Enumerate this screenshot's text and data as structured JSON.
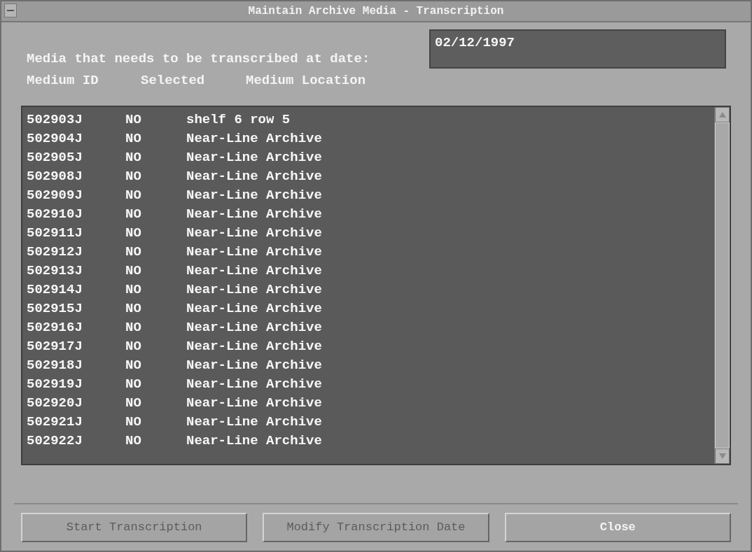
{
  "window": {
    "title": "Maintain Archive Media - Transcription"
  },
  "date_prompt": "Media that needs to be transcribed at date:",
  "date_field": {
    "value": "02/12/1997"
  },
  "table": {
    "columns": [
      "Medium ID",
      "Selected",
      "Medium Location"
    ],
    "rows": [
      [
        "502903J",
        "NO",
        "shelf 6 row 5"
      ],
      [
        "502904J",
        "NO",
        "Near-Line Archive"
      ],
      [
        "502905J",
        "NO",
        "Near-Line Archive"
      ],
      [
        "502908J",
        "NO",
        "Near-Line Archive"
      ],
      [
        "502909J",
        "NO",
        "Near-Line Archive"
      ],
      [
        "502910J",
        "NO",
        "Near-Line Archive"
      ],
      [
        "502911J",
        "NO",
        "Near-Line Archive"
      ],
      [
        "502912J",
        "NO",
        "Near-Line Archive"
      ],
      [
        "502913J",
        "NO",
        "Near-Line Archive"
      ],
      [
        "502914J",
        "NO",
        "Near-Line Archive"
      ],
      [
        "502915J",
        "NO",
        "Near-Line Archive"
      ],
      [
        "502916J",
        "NO",
        "Near-Line Archive"
      ],
      [
        "502917J",
        "NO",
        "Near-Line Archive"
      ],
      [
        "502918J",
        "NO",
        "Near-Line Archive"
      ],
      [
        "502919J",
        "NO",
        "Near-Line Archive"
      ],
      [
        "502920J",
        "NO",
        "Near-Line Archive"
      ],
      [
        "502921J",
        "NO",
        "Near-Line Archive"
      ],
      [
        "502922J",
        "NO",
        "Near-Line Archive"
      ]
    ]
  },
  "buttons": [
    {
      "label": "Start Transcription",
      "disabled": true
    },
    {
      "label": "Modify Transcription Date",
      "disabled": true
    },
    {
      "label": "Close",
      "disabled": false
    }
  ]
}
